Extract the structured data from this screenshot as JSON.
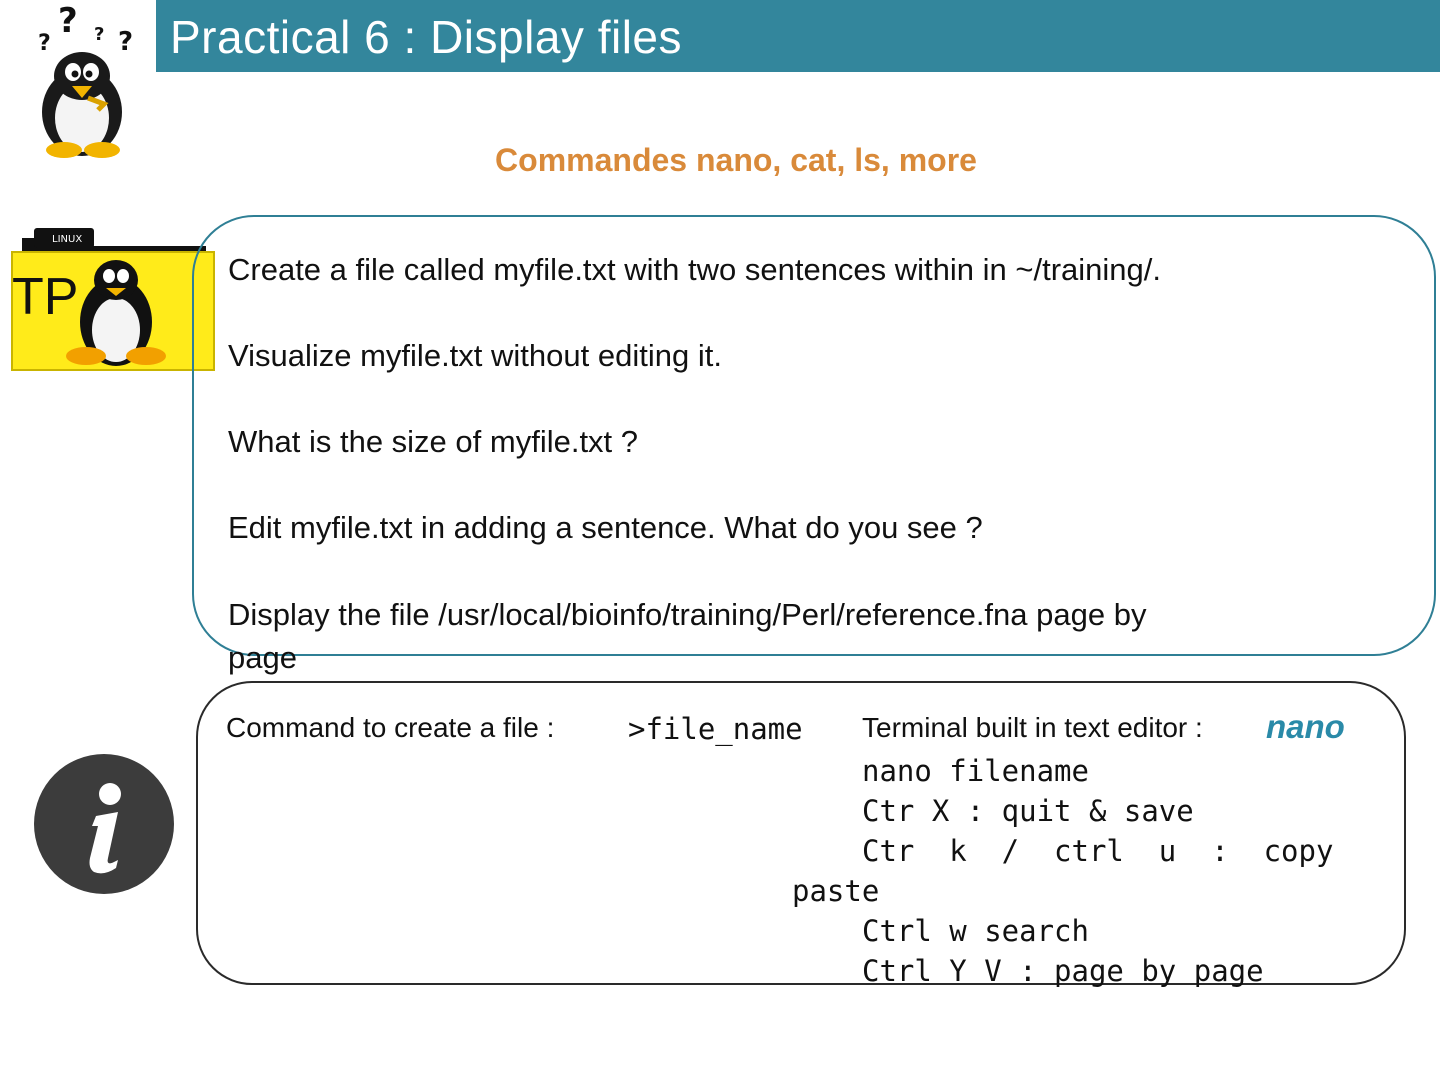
{
  "header": {
    "title": "Practical 6 : Display files"
  },
  "subtitle": "Commandes nano, cat, ls, more",
  "icons": {
    "logo": "thinking-penguin-icon",
    "folder": "tp-linux-folder-icon",
    "folder_tag": "LINUX",
    "folder_label": "TP",
    "info": "info-icon"
  },
  "colors": {
    "header": "#33869c",
    "subtitle": "#d98a3a",
    "task_border": "#2f7f95",
    "nano": "#2a8aa8"
  },
  "tasks": [
    "Create a file called myfile.txt with two sentences within in ~/training/.",
    "Visualize myfile.txt without editing it.",
    "What is the size of myfile.txt ?",
    "Edit myfile.txt in adding a sentence. What do you see ?",
    "Display the file /usr/local/bioinfo/training/Perl/reference.fna page by",
    "page"
  ],
  "info": {
    "create_label": "Command to create a file :",
    "create_command": ">file_name",
    "editor_label": "Terminal built in text editor :",
    "editor_name": "nano",
    "nano_lines": [
      "nano filename",
      "Ctr X : quit & save",
      "Ctr  k  /  ctrl  u  :  copy",
      "Ctrl w search",
      "Ctrl Y V : page by page"
    ],
    "paste_word": "paste"
  }
}
